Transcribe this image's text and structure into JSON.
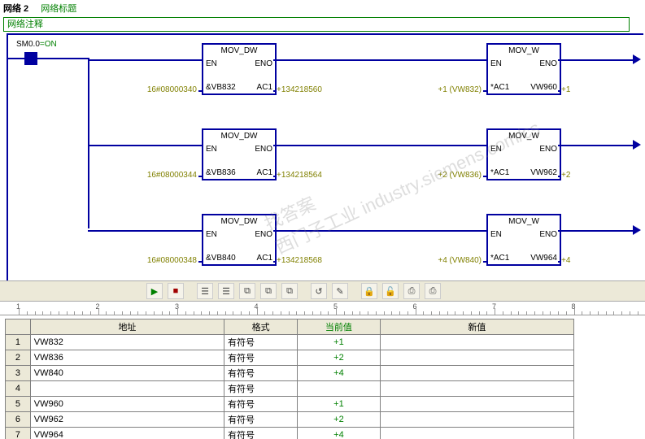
{
  "header": {
    "net_label": "网络 2",
    "net_title": "网络标题",
    "comment": "网络注释"
  },
  "contact": {
    "name": "SM0.0",
    "state": "=ON"
  },
  "blocks": [
    {
      "row": 0,
      "col": 0,
      "type": "MOV_DW",
      "in_label": "16#08000340",
      "in_pin": "&VB832",
      "out_pin": "AC1",
      "out_label": "+134218560"
    },
    {
      "row": 0,
      "col": 1,
      "type": "MOV_W",
      "in_label": "+1 (VW832)",
      "in_pin": "*AC1",
      "out_pin": "VW960",
      "out_label": "+1"
    },
    {
      "row": 1,
      "col": 0,
      "type": "MOV_DW",
      "in_label": "16#08000344",
      "in_pin": "&VB836",
      "out_pin": "AC1",
      "out_label": "+134218564"
    },
    {
      "row": 1,
      "col": 1,
      "type": "MOV_W",
      "in_label": "+2 (VW836)",
      "in_pin": "*AC1",
      "out_pin": "VW962",
      "out_label": "+2"
    },
    {
      "row": 2,
      "col": 0,
      "type": "MOV_DW",
      "in_label": "16#08000348",
      "in_pin": "&VB840",
      "out_pin": "AC1",
      "out_label": "+134218568"
    },
    {
      "row": 2,
      "col": 1,
      "type": "MOV_W",
      "in_label": "+4 (VW840)",
      "in_pin": "*AC1",
      "out_pin": "VW964",
      "out_label": "+4"
    }
  ],
  "fb_ports": {
    "en": "EN",
    "eno": "ENO"
  },
  "toolbar_icons": [
    "▶",
    "■",
    "|",
    "☰",
    "☰",
    "⧉",
    "⧉",
    "⧉",
    "|",
    "↺",
    "✎",
    "|",
    "🔒",
    "🔓",
    "⎙",
    "⎙"
  ],
  "ruler_numbers": [
    "1",
    "2",
    "3",
    "4",
    "5",
    "6",
    "7",
    "8"
  ],
  "watch": {
    "headers": {
      "addr": "地址",
      "fmt": "格式",
      "cur": "当前值",
      "newv": "新值"
    },
    "rows": [
      {
        "n": "1",
        "addr": "VW832",
        "fmt": "有符号",
        "cur": "+1",
        "newv": ""
      },
      {
        "n": "2",
        "addr": "VW836",
        "fmt": "有符号",
        "cur": "+2",
        "newv": ""
      },
      {
        "n": "3",
        "addr": "VW840",
        "fmt": "有符号",
        "cur": "+4",
        "newv": ""
      },
      {
        "n": "4",
        "addr": "",
        "fmt": "有符号",
        "cur": "",
        "newv": ""
      },
      {
        "n": "5",
        "addr": "VW960",
        "fmt": "有符号",
        "cur": "+1",
        "newv": ""
      },
      {
        "n": "6",
        "addr": "VW962",
        "fmt": "有符号",
        "cur": "+2",
        "newv": ""
      },
      {
        "n": "7",
        "addr": "VW964",
        "fmt": "有符号",
        "cur": "+4",
        "newv": ""
      }
    ]
  },
  "watermark": "找答案\n西门子工业 industry.siemens.com/cs"
}
